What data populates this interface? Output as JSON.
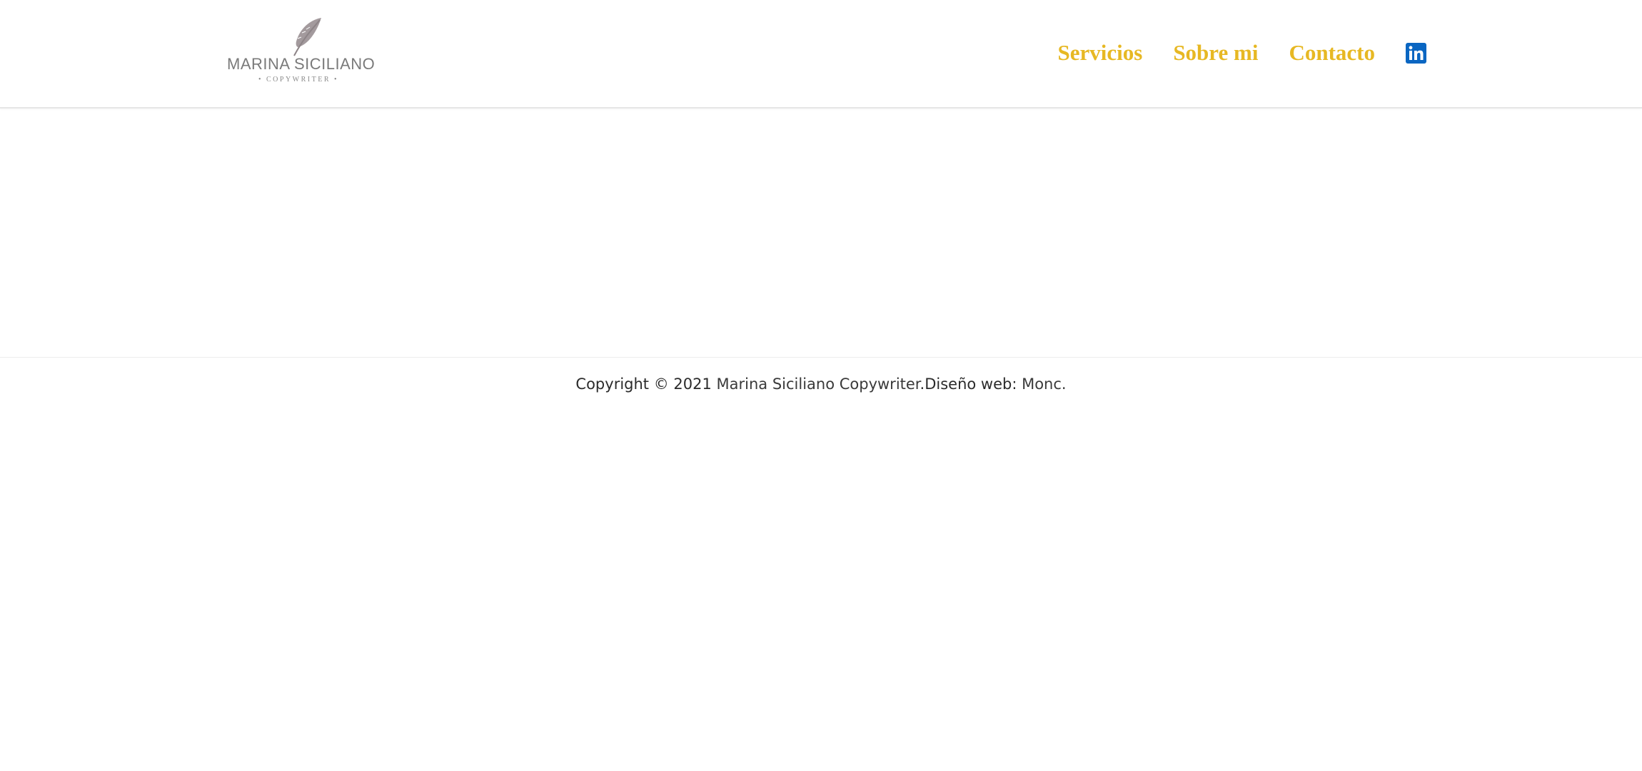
{
  "header": {
    "logo": {
      "name": "MARINA SICILIANO",
      "subtitle": "• COPYWRITER •",
      "feather_color": "#a39a9d"
    },
    "nav": {
      "items": [
        {
          "label": "Servicios"
        },
        {
          "label": "Sobre mi"
        },
        {
          "label": "Contacto"
        }
      ],
      "link_color": "#e7b823",
      "social_icon": "linkedin-icon",
      "social_color": "#0a66c2"
    }
  },
  "footer": {
    "copyright_prefix": "Copyright © 2021 ",
    "site_link": "Marina Siciliano Copywriter",
    "separator": ".",
    "design_prefix": "Diseño web: ",
    "designer_link": "Monc."
  }
}
